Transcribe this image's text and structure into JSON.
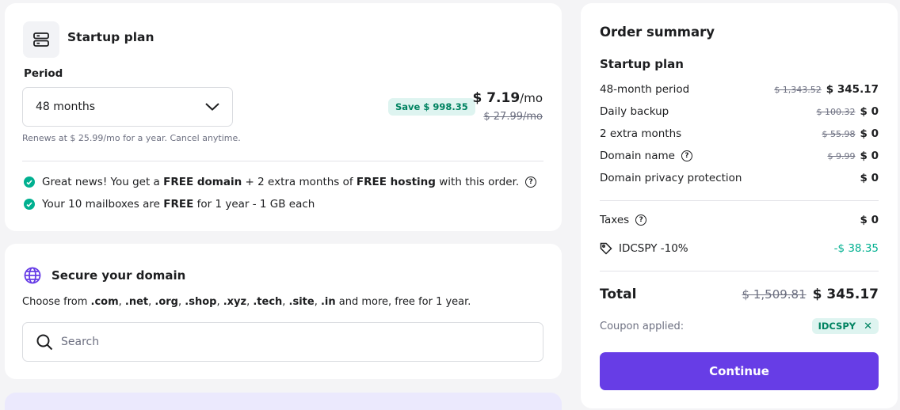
{
  "plan": {
    "title": "Startup plan",
    "period_label": "Period",
    "period_value": "48 months",
    "save_badge": "Save $ 998.35",
    "price": "$ 7.19",
    "price_unit": "/mo",
    "old_price": "$ 27.99/mo",
    "renews": "Renews at $ 25.99/mo for a year. Cancel anytime.",
    "benefit1": {
      "t1": "Great news! You get a ",
      "b1": "FREE domain",
      "t2": " + 2 extra months of ",
      "b2": "FREE hosting",
      "t3": " with this order."
    },
    "benefit2": {
      "t1": "Your 10 mailboxes are ",
      "b1": "FREE",
      "t2": " for 1 year - 1 GB each"
    },
    "help_glyph": "?"
  },
  "domain": {
    "title": "Secure your domain",
    "desc_prefix": "Choose from ",
    "tlds": [
      ".com",
      ".net",
      ".org",
      ".shop",
      ".xyz",
      ".tech",
      ".site",
      ".in"
    ],
    "desc_suffix": " and more, free for 1 year.",
    "search_placeholder": "Search"
  },
  "summary": {
    "title": "Order summary",
    "plan": "Startup plan",
    "rows": [
      {
        "label": "48-month period",
        "old": "$ 1,343.52",
        "new": "$ 345.17"
      },
      {
        "label": "Daily backup",
        "old": "$ 100.32",
        "new": "$ 0"
      },
      {
        "label": "2 extra months",
        "old": "$ 55.98",
        "new": "$ 0"
      },
      {
        "label": "Domain name",
        "old": "$ 9.99",
        "new": "$ 0"
      },
      {
        "label": "Domain privacy protection",
        "old": "",
        "new": "$ 0"
      }
    ],
    "taxes_label": "Taxes",
    "taxes_value": "$ 0",
    "coupon_code_label": "IDCSPY -10%",
    "coupon_discount": "-$ 38.35",
    "total_label": "Total",
    "total_old": "$ 1,509.81",
    "total_new": "$ 345.17",
    "coupon_applied_label": "Coupon applied:",
    "coupon_chip": "IDCSPY",
    "coupon_remove": "✕",
    "continue": "Continue"
  },
  "colors": {
    "accent": "#673de6",
    "success": "#00b090",
    "badge_bg": "#def4f0"
  }
}
